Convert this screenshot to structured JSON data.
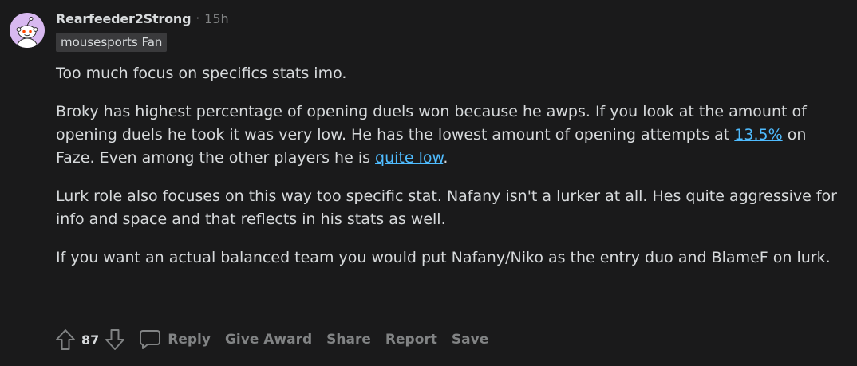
{
  "comment": {
    "username": "Rearfeeder2Strong",
    "separator": "·",
    "time": "15h",
    "flair": "mousesports Fan",
    "paragraphs": {
      "p1": "Too much focus on specifics stats imo.",
      "p2_a": "Broky has highest percentage of opening duels won because he awps. If you look at the amount of opening duels he took it was very low. He has the lowest amount of opening attempts at ",
      "p2_link1": "13.5%",
      "p2_b": " on Faze. Even among the other players he is ",
      "p2_link2": "quite low",
      "p2_c": ".",
      "p3": "Lurk role also focuses on this way too specific stat. Nafany isn't a lurker at all. Hes quite aggressive for info and space and that reflects in his stats as well.",
      "p4": "If you want an actual balanced team you would put Nafany/Niko as the entry duo and BlameF on lurk."
    }
  },
  "actions": {
    "score": "87",
    "reply": "Reply",
    "give_award": "Give Award",
    "share": "Share",
    "report": "Report",
    "save": "Save"
  },
  "icons": {
    "upvote": "upvote-arrow-icon",
    "downvote": "downvote-arrow-icon",
    "reply": "speech-bubble-icon",
    "avatar": "reddit-snoo-avatar"
  },
  "colors": {
    "background": "#1a1a1b",
    "text": "#d7dadc",
    "muted": "#818384",
    "link": "#4fbcff",
    "flair_bg": "#3a3a3c",
    "avatar_bg": "#d8b9f0"
  }
}
